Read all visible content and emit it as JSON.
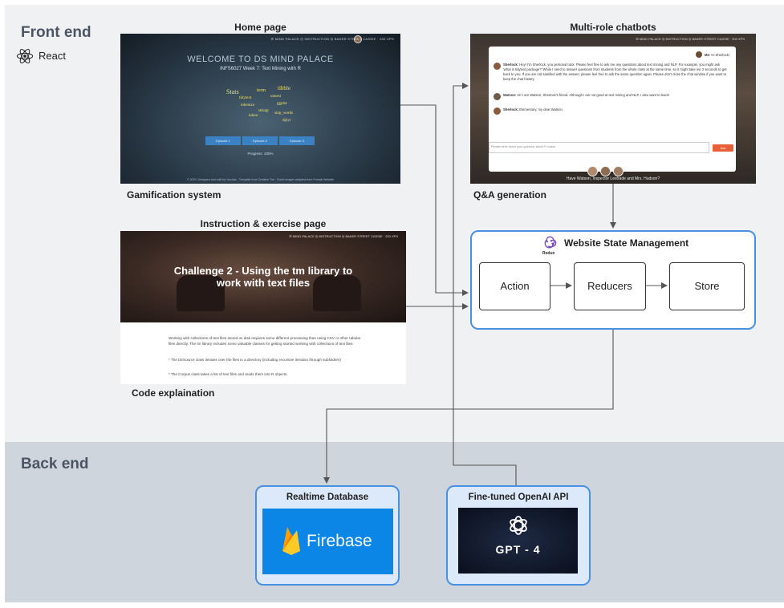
{
  "sections": {
    "front_end": "Front end",
    "back_end": "Back end"
  },
  "framework": {
    "label": "React",
    "icon": "react-icon"
  },
  "home": {
    "title": "Home page",
    "caption": "Gamification system",
    "screen": {
      "nav": "☰ MIND PALACE   ◎ INSTRUCTION   ◎ BAKER STREET        CASSIE · 200 XPS",
      "welcome": "WELCOME TO DS MIND PALACE",
      "week": "INFS6027 Week 7: Text Mining with R",
      "words": [
        "Stats",
        "tidytext",
        "term",
        "tokenize",
        "stringr",
        "unnest",
        "token",
        "tibble",
        "stop_words",
        "ggplot",
        "dplyr"
      ],
      "episodes": [
        "Episode 1",
        "Episode 2",
        "Episode 3"
      ],
      "progress": "Progress: 100%",
      "footer": "© 2023, Designed and built by Yunxiao · Template from Creative Tim · Some images adapted from Freepik Website"
    }
  },
  "chat": {
    "title": "Multi-role chatbots",
    "caption": "Q&A generation",
    "screen": {
      "nav": "☰ MIND PALACE   ◎ INSTRUCTION   ◎ BAKER STREET        CASSIE · 200 XPS",
      "me_label": "Me:",
      "me_text": "Hi Sherlock!",
      "messages": [
        {
          "speaker": "Sherlock:",
          "text": "Hey! I'm Sherlock, you personal tutor. Please feel free to ask me any questions about text mining and NLP. For example, you might ask 'what is tidytext package?' While I need to answer questions from students from the whole class at the same time, so it might take me 2 seconds to get back to you. If you are not satisfied with the answer, please feel free to ask the same question again. Please don't close the chat window if you want to keep the chat history."
        },
        {
          "speaker": "Watson:",
          "text": "Hi! I am Watson, Sherlock's friend. Although I am not good at text mining and NLP, I also want to learn!"
        },
        {
          "speaker": "Sherlock:",
          "text": "Elementary, my dear Watson."
        }
      ],
      "input_placeholder": "Please write down your question about R codes",
      "ask_button": "Ask",
      "have_text": "Have Watson, Inspector Lestrade and Mrs. Hudson?"
    }
  },
  "instruction": {
    "title": "Instruction & exercise page",
    "caption": "Code explaination",
    "screen": {
      "nav": "☰ MIND PALACE   ◎ INSTRUCTION   ◎ BAKER STREET        CASSIE · 200 XPS",
      "hero_title": "Challenge 2 - Using the tm library to work with text files",
      "para1": "Working with collections of text files stored on disk requires some different processing than using CSV or other tabular files directly. The tm library includes some valuable classes for getting started working with collections of text files:",
      "bullet1": "* The DirSource class iterates over the files in a directory (including recursive iteration through subfolders)",
      "bullet2": "* The Corpus class takes a list of text files and reads them into R objects."
    }
  },
  "redux": {
    "title": "Website State Management",
    "logo_label": "Redux",
    "nodes": [
      "Action",
      "Reducers",
      "Store"
    ]
  },
  "database": {
    "title": "Realtime Database",
    "product": "Firebase"
  },
  "api": {
    "title": "Fine-tuned OpenAI API",
    "product": "GPT - 4"
  }
}
